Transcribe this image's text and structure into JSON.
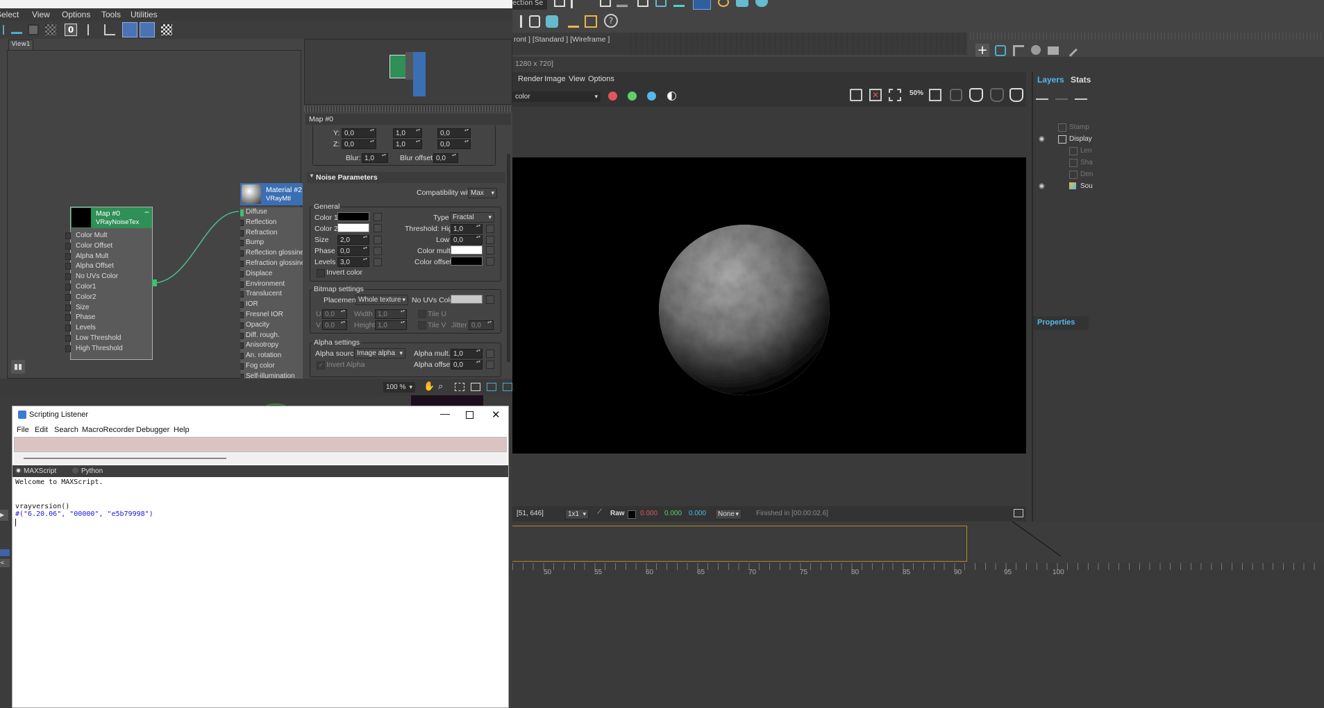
{
  "slate": {
    "menu": [
      "Select",
      "View",
      "Options",
      "Tools",
      "Utilities"
    ],
    "zoom_toolbar_value": "0",
    "view_tab": "View1",
    "node_map": {
      "title": "Map #0",
      "subtitle": "VRayNoiseTex",
      "collapse": "−",
      "ports": [
        "Color Mult",
        "Color Offset",
        "Alpha Mult",
        "Alpha Offset",
        "No UVs Color",
        "Color1",
        "Color2",
        "Size",
        "Phase",
        "Levels",
        "Low Threshold",
        "High Threshold"
      ]
    },
    "node_material": {
      "title": "Material #2",
      "subtitle": "VRayMtl",
      "slots": [
        "Diffuse",
        "Reflection",
        "Refraction",
        "Bump",
        "Reflection glossines",
        "Refraction glossine",
        "Displace",
        "Environment",
        "Translucent",
        "IOR",
        "Fresnel IOR",
        "Opacity",
        "Diff. rough.",
        "Anisotropy",
        "An. rotation",
        "Fog color",
        "Self-illumination"
      ]
    },
    "zoom_percent": "100 %",
    "params": {
      "header": "Map #0",
      "coords": {
        "y": {
          "label": "Y:",
          "values": [
            "0,0",
            "1,0",
            "0,0"
          ]
        },
        "z": {
          "label": "Z:",
          "values": [
            "0,0",
            "1,0",
            "0,0"
          ]
        },
        "blur_label": "Blur:",
        "blur": "1,0",
        "blur_offset_label": "Blur offset:",
        "blur_offset": "0,0"
      },
      "rollout_title": "Noise Parameters",
      "compat_label": "Compatibility with",
      "compat_value": "Max",
      "general": {
        "title": "General",
        "color1": "Color 1",
        "color2": "Color 2",
        "size_label": "Size",
        "size": "2,0",
        "phase_label": "Phase",
        "phase": "0,0",
        "levels_label": "Levels",
        "levels": "3,0",
        "invert": "Invert color",
        "type_label": "Type",
        "type": "Fractal",
        "thr_high_label": "Threshold: High",
        "thr_high": "1,0",
        "low_label": "Low",
        "low": "0,0",
        "color_mult_label": "Color mult.",
        "color_offset_label": "Color offset",
        "color1_hex": "#000000",
        "color2_hex": "#ffffff",
        "color_mult_hex": "#ffffff",
        "color_offset_hex": "#000000"
      },
      "bitmap": {
        "title": "Bitmap settings",
        "placement_label": "Placement",
        "placement": "Whole texture",
        "no_uvs_label": "No UVs Color",
        "u_label": "U",
        "u": "0,0",
        "v_label": "V",
        "v": "0,0",
        "width_label": "Width",
        "width": "1,0",
        "height_label": "Height",
        "height": "1,0",
        "tile_u": "Tile U",
        "tile_v": "Tile V",
        "jitter_label": "Jitter",
        "jitter": "0,0"
      },
      "alpha": {
        "title": "Alpha settings",
        "source_label": "Alpha source",
        "source": "Image alpha",
        "mult_label": "Alpha mult.",
        "mult": "1,0",
        "offset_label": "Alpha offset",
        "offset": "0,0",
        "invert": "Invert Alpha"
      }
    }
  },
  "max": {
    "selection_set": "ection Se",
    "viewport_label": "ront ] [Standard ] [Wireframe ]",
    "ruler_ticks": [
      "50",
      "55",
      "60",
      "65",
      "70",
      "75",
      "80",
      "85",
      "90",
      "95",
      "100"
    ]
  },
  "vfb": {
    "resolution": "1280 x 720]",
    "menu": [
      "Render",
      "Image",
      "View",
      "Options"
    ],
    "channel": "color",
    "status": {
      "coords": "[51, 646]",
      "scale": "1x1",
      "raw": "Raw",
      "r": "0.000",
      "g": "0.000",
      "b": "0.000",
      "none": "None",
      "finished": "Finished in [00:00:02.6]"
    },
    "toolbar_50": "50",
    "tabs": [
      "Layers",
      "Stats"
    ],
    "layers": [
      "Stamp",
      "Display",
      "Len",
      "Sha",
      "Den",
      "Sou"
    ],
    "properties": "Properties",
    "colors": {
      "red": "#e0555f",
      "green": "#5fd06b",
      "blue": "#52b8ee"
    }
  },
  "listener": {
    "title": "Scripting Listener",
    "menu": [
      "File",
      "Edit",
      "Search",
      "MacroRecorder",
      "Debugger",
      "Help"
    ],
    "radio_maxscript": "MAXScript",
    "radio_python": "Python",
    "lines": [
      "Welcome to MAXScript.",
      "",
      "",
      "vrayversion()"
    ],
    "result": "#(\"6.20.06\", \"00000\", \"e5b79998\")"
  }
}
